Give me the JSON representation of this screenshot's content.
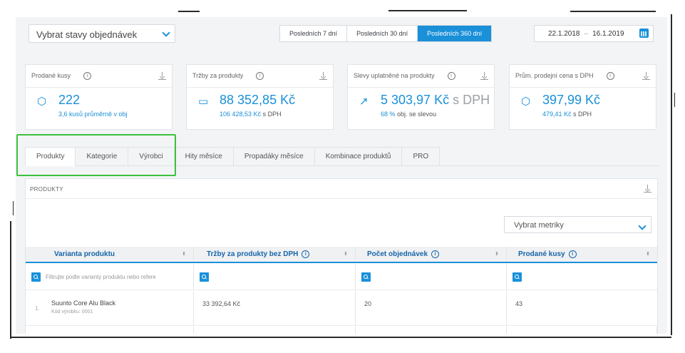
{
  "top_bar": {
    "order_state_select": "Vybrat stavy objednávek",
    "ranges": [
      {
        "label": "Posledních 7 dní",
        "active": false
      },
      {
        "label": "Posledních 30 dní",
        "active": false
      },
      {
        "label": "Posledních 360 dní",
        "active": true
      }
    ],
    "date_from": "22.1.2018",
    "date_sep": "–",
    "date_to": "16.1.2019"
  },
  "kpis": [
    {
      "title": "Prodané kusy",
      "icon": "package-icon",
      "value": "222",
      "value_suffix": "",
      "sub_highlight": "3,6 kusů průměrně v obj",
      "sub_rest": ""
    },
    {
      "title": "Tržby za produkty",
      "icon": "cash-icon",
      "value": "88 352,85 Kč",
      "value_suffix": "",
      "sub_highlight": "106 428,53 Kč",
      "sub_rest": " s DPH"
    },
    {
      "title": "Slevy uplatněné na produkty",
      "icon": "trend-up-icon",
      "value": "5 303,97 Kč",
      "value_suffix": " s DPH",
      "sub_highlight": "68 %",
      "sub_rest": " obj. se slevou"
    },
    {
      "title": "Prům. prodejní cena s DPH",
      "icon": "box-icon",
      "value": "397,99 Kč",
      "value_suffix": "",
      "sub_highlight": "479,41 Kč",
      "sub_rest": " s DPH"
    }
  ],
  "tabs": [
    {
      "label": "Produkty",
      "active": true
    },
    {
      "label": "Kategorie",
      "active": false
    },
    {
      "label": "Výrobci",
      "active": false
    },
    {
      "label": "Hity měsíce",
      "active": false
    },
    {
      "label": "Propadáky měsíce",
      "active": false
    },
    {
      "label": "Kombinace produktů",
      "active": false
    },
    {
      "label": "PRO",
      "active": false
    }
  ],
  "panel": {
    "title": "PRODUKTY",
    "metric_select": "Vybrat metriky",
    "columns": [
      {
        "label": "Varianta produktu",
        "info": false
      },
      {
        "label": "Tržby za produkty bez DPH",
        "info": true
      },
      {
        "label": "Počet objednávek",
        "info": true
      },
      {
        "label": "Prodané kusy",
        "info": true
      }
    ],
    "filter_placeholder": "Filtrujte podle varianty produktu nebo refere",
    "rows": [
      {
        "num": "1.",
        "name": "Suunto Core Alu Black",
        "code": "Kód výrobku: 0001",
        "revenue": "33 392,64 Kč",
        "orders": "20",
        "pieces": "43"
      }
    ]
  },
  "colors": {
    "accent": "#1a90d9",
    "highlight": "#3cc13c"
  }
}
